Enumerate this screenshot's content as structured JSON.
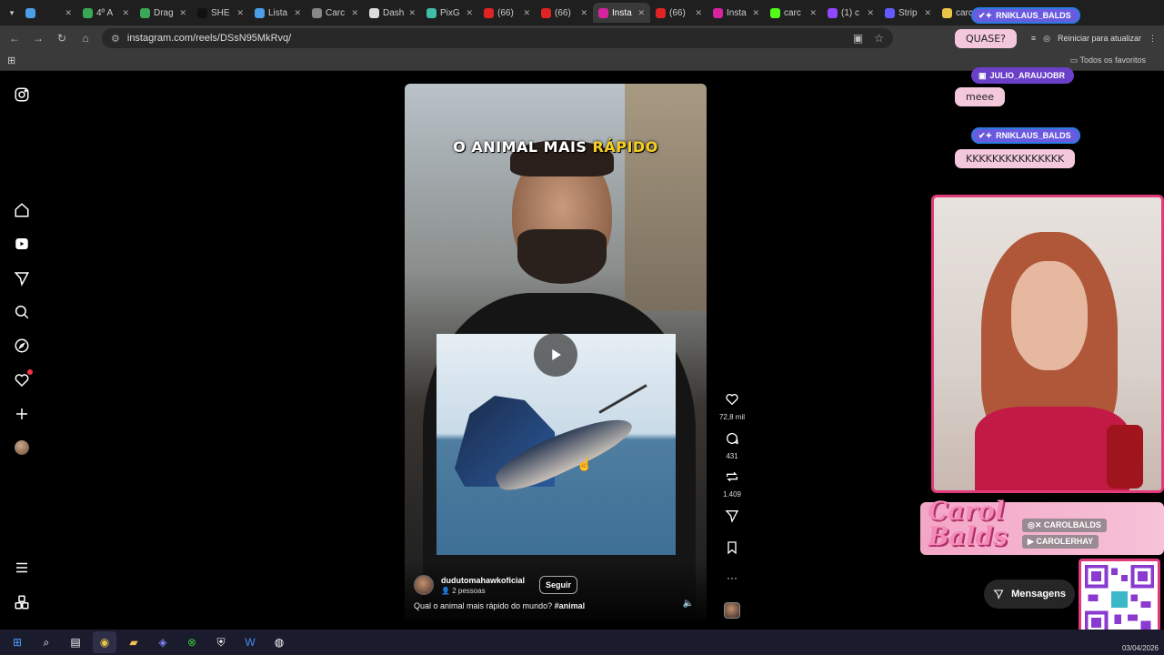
{
  "browser": {
    "tabs": [
      {
        "label": "",
        "color": "#4a9fe8"
      },
      {
        "label": "4º A",
        "color": "#3aa757"
      },
      {
        "label": "Drag",
        "color": "#3aa757"
      },
      {
        "label": "SHE",
        "color": "#111111",
        "glyph": "S"
      },
      {
        "label": "Lista",
        "color": "#4a9fe8"
      },
      {
        "label": "Carc",
        "color": "#888888"
      },
      {
        "label": "Dash",
        "color": "#dddddd"
      },
      {
        "label": "PixG",
        "color": "#3fbfa6"
      },
      {
        "label": "(66)",
        "color": "#e02424"
      },
      {
        "label": "(66)",
        "color": "#e02424"
      },
      {
        "label": "Insta",
        "color": "#d6249f",
        "active": true
      },
      {
        "label": "(66)",
        "color": "#e02424"
      },
      {
        "label": "Insta",
        "color": "#d6249f"
      },
      {
        "label": "carc",
        "color": "#53fc18",
        "glyph": "K"
      },
      {
        "label": "(1) c",
        "color": "#9146ff"
      },
      {
        "label": "Strip",
        "color": "#635bff"
      },
      {
        "label": "carc",
        "color": "#e8c547"
      }
    ],
    "url": "instagram.com/reels/DSsN95MkRvq/",
    "reload_label": "Reiniciar para atualizar",
    "bookmarks_all": "Todos os favoritos"
  },
  "video": {
    "title_part1": "O ANIMAL MAIS ",
    "title_part2": "RÁPIDO",
    "author": "dudutomahawkoficial",
    "audience": "2 pessoas",
    "follow_label": "Seguir",
    "caption_text": "Qual o animal mais rápido do mundo? ",
    "caption_tag": "#animal"
  },
  "actions": {
    "likes": "72,8 mil",
    "comments": "431",
    "reposts": "1.409"
  },
  "chat": {
    "user1": "RNIKLAUS_BALDS",
    "msg1": "QUASE?",
    "user2": "JULIO_ARAUJOBR",
    "msg2": "meee",
    "user3": "RNIKLAUS_BALDS",
    "msg3": "KKKKKKKKKKKKKKK"
  },
  "overlay": {
    "logo": "Carol Balds",
    "social_x": "CAROLBALDS",
    "social_yt": "CAROLERHAY",
    "messages_label": "Mensagens"
  },
  "taskbar": {
    "date": "03/04/2026"
  }
}
